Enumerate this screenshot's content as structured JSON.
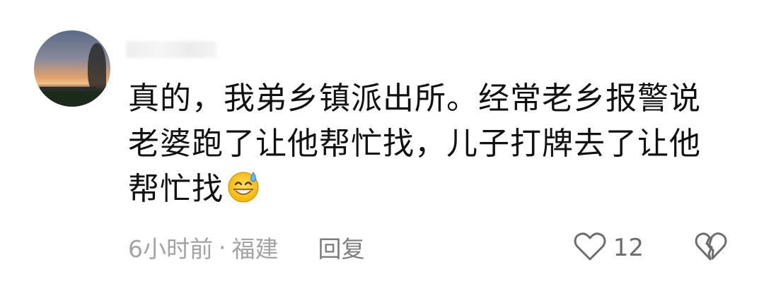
{
  "comment": {
    "content_lines": [
      "真的，我弟乡镇派出所。经常老乡报警说",
      "老婆跑了让他帮忙找，儿子打牌去了让他",
      "帮忙找"
    ],
    "emoji": "grinning-sweat-emoji",
    "time": "6小时前",
    "separator": "·",
    "location": "福建",
    "reply_label": "回复",
    "like_count": "12",
    "icons": {
      "like": "heart-outline-icon",
      "dislike": "broken-heart-icon"
    },
    "colors": {
      "text": "#111111",
      "meta": "#a3a3a3",
      "icon": "#6d6d6d"
    }
  }
}
